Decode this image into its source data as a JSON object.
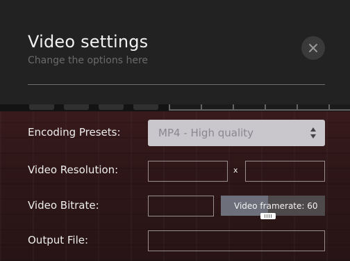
{
  "dialog": {
    "title": "Video settings",
    "subtitle": "Change the options here",
    "close_icon": "close-icon"
  },
  "form": {
    "encoding_presets": {
      "label": "Encoding Presets:",
      "selected": "MP4 - High quality"
    },
    "video_resolution": {
      "label": "Video Resolution:",
      "width_value": "",
      "separator": "x",
      "height_value": ""
    },
    "video_bitrate": {
      "label": "Video Bitrate:",
      "value": ""
    },
    "video_framerate": {
      "label": "Video framerate: 60",
      "value": 60,
      "fill_fraction": 0.45
    },
    "output_file": {
      "label": "Output File:",
      "value": ""
    }
  },
  "colors": {
    "header_bg": "#222222",
    "select_bg": "#c9c6cc",
    "slider_fill": "#6d6f7a"
  }
}
